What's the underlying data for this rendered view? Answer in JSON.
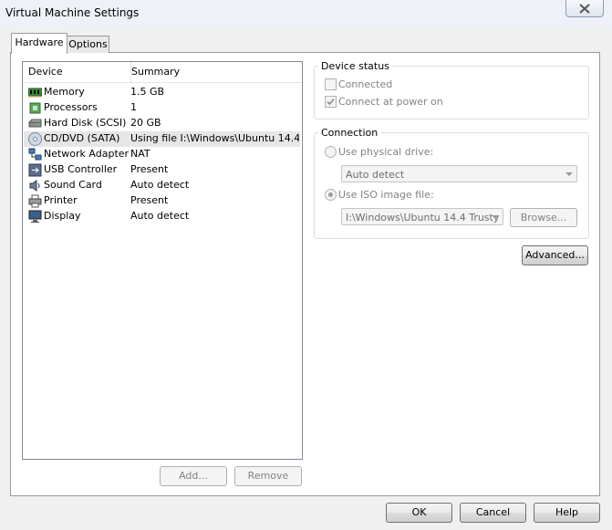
{
  "window": {
    "title": "Virtual Machine Settings"
  },
  "tabs": [
    {
      "label": "Hardware"
    },
    {
      "label": "Options"
    }
  ],
  "device_list": {
    "columns": {
      "device": "Device",
      "summary": "Summary"
    },
    "rows": [
      {
        "icon": "memory-icon",
        "device": "Memory",
        "summary": "1.5 GB"
      },
      {
        "icon": "processor-icon",
        "device": "Processors",
        "summary": "1"
      },
      {
        "icon": "hard-disk-icon",
        "device": "Hard Disk (SCSI)",
        "summary": "20 GB"
      },
      {
        "icon": "cd-dvd-icon",
        "device": "CD/DVD (SATA)",
        "summary": "Using file I:\\Windows\\Ubuntu 14.4 ..."
      },
      {
        "icon": "network-adapter-icon",
        "device": "Network Adapter",
        "summary": "NAT"
      },
      {
        "icon": "usb-icon",
        "device": "USB Controller",
        "summary": "Present"
      },
      {
        "icon": "sound-card-icon",
        "device": "Sound Card",
        "summary": "Auto detect"
      },
      {
        "icon": "printer-icon",
        "device": "Printer",
        "summary": "Present"
      },
      {
        "icon": "display-icon",
        "device": "Display",
        "summary": "Auto detect"
      }
    ],
    "selected_index": 3,
    "add_label": "Add...",
    "remove_label": "Remove"
  },
  "device_status": {
    "title": "Device status",
    "connected_label": "Connected",
    "connected_checked": false,
    "connect_power_on_label": "Connect at power on",
    "connect_power_on_checked": true
  },
  "connection": {
    "title": "Connection",
    "physical_drive_label": "Use physical drive:",
    "physical_drive_value": "Auto detect",
    "iso_label": "Use ISO image file:",
    "iso_selected": true,
    "iso_value": "I:\\Windows\\Ubuntu 14.4 Trusty",
    "browse_label": "Browse..."
  },
  "advanced_label": "Advanced...",
  "footer": {
    "ok_label": "OK",
    "cancel_label": "Cancel",
    "help_label": "Help"
  }
}
